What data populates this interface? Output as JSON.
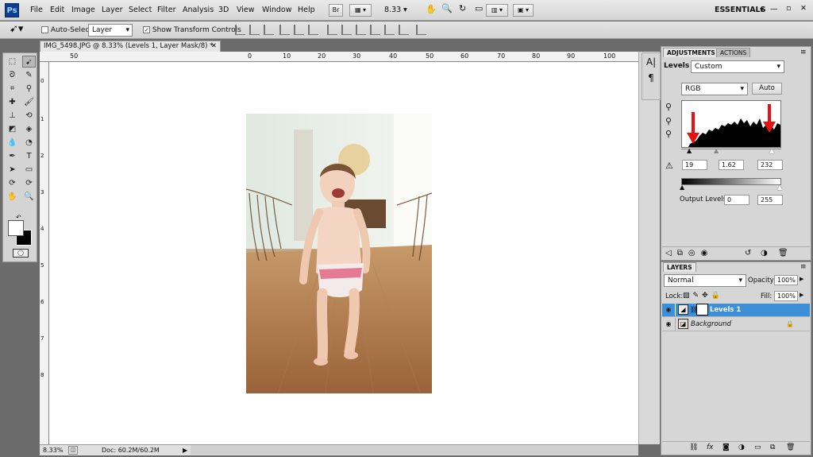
{
  "app": {
    "logo": "Ps",
    "workspace": "ESSENTIALS"
  },
  "menu": [
    "File",
    "Edit",
    "Image",
    "Layer",
    "Select",
    "Filter",
    "Analysis",
    "3D",
    "View",
    "Window",
    "Help"
  ],
  "appbar": {
    "bridge_label": "Br",
    "zoom": "8.33"
  },
  "options": {
    "auto_select_label": "Auto-Select:",
    "auto_select_value": "Layer",
    "transform_label": "Show Transform Controls"
  },
  "document": {
    "tab_title": "IMG_5498.JPG @ 8.33% (Levels 1, Layer Mask/8) *",
    "ruler_h": [
      "50",
      "0",
      "10",
      "20",
      "30",
      "40",
      "50",
      "60",
      "70",
      "80",
      "90",
      "100"
    ],
    "ruler_v": [
      "0",
      "1",
      "2",
      "3",
      "4",
      "5",
      "6",
      "7",
      "8"
    ],
    "status_zoom": "8.33%",
    "status_doc": "Doc: 60.2M/60.2M"
  },
  "adjustments": {
    "tabs": [
      "ADJUSTMENTS",
      "ACTIONS"
    ],
    "panel_label": "Levels",
    "preset": "Custom",
    "channel": "RGB",
    "auto_label": "Auto",
    "input_black": "19",
    "input_gamma": "1.62",
    "input_white": "232",
    "output_label": "Output Levels:",
    "output_black": "0",
    "output_white": "255"
  },
  "layers": {
    "tab": "LAYERS",
    "blend_mode": "Normal",
    "opacity_label": "Opacity:",
    "opacity_value": "100%",
    "lock_label": "Lock:",
    "fill_label": "Fill:",
    "fill_value": "100%",
    "items": [
      {
        "name": "Levels 1",
        "selected": true
      },
      {
        "name": "Background",
        "selected": false
      }
    ]
  },
  "colors": {
    "accent": "#3d8fd8",
    "canvas_bg": "#ffffff",
    "chrome": "#d6d6d6",
    "arrow": "#e81010"
  }
}
